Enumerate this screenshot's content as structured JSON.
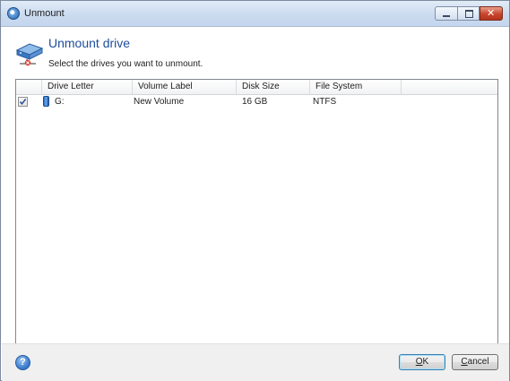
{
  "window": {
    "title": "Unmount",
    "app_icon": "app-logo-icon",
    "controls": [
      "minimize",
      "maximize",
      "close"
    ]
  },
  "header": {
    "heading": "Unmount drive",
    "subheading": "Select the drives you want to unmount."
  },
  "table": {
    "columns": [
      "Drive Letter",
      "Volume Label",
      "Disk Size",
      "File System"
    ],
    "rows": [
      {
        "checked": true,
        "icon": "drive-icon",
        "drive_letter": "G:",
        "volume_label": "New Volume",
        "disk_size": "16 GB",
        "file_system": "NTFS"
      }
    ]
  },
  "footer": {
    "help_icon": "help-icon",
    "ok_accel": "O",
    "ok_rest": "K",
    "cancel_accel": "C",
    "cancel_rest": "ancel"
  },
  "colors": {
    "heading": "#1e4e9d",
    "titlebar": "#cbdbef",
    "footer": "#f0f0f0"
  }
}
